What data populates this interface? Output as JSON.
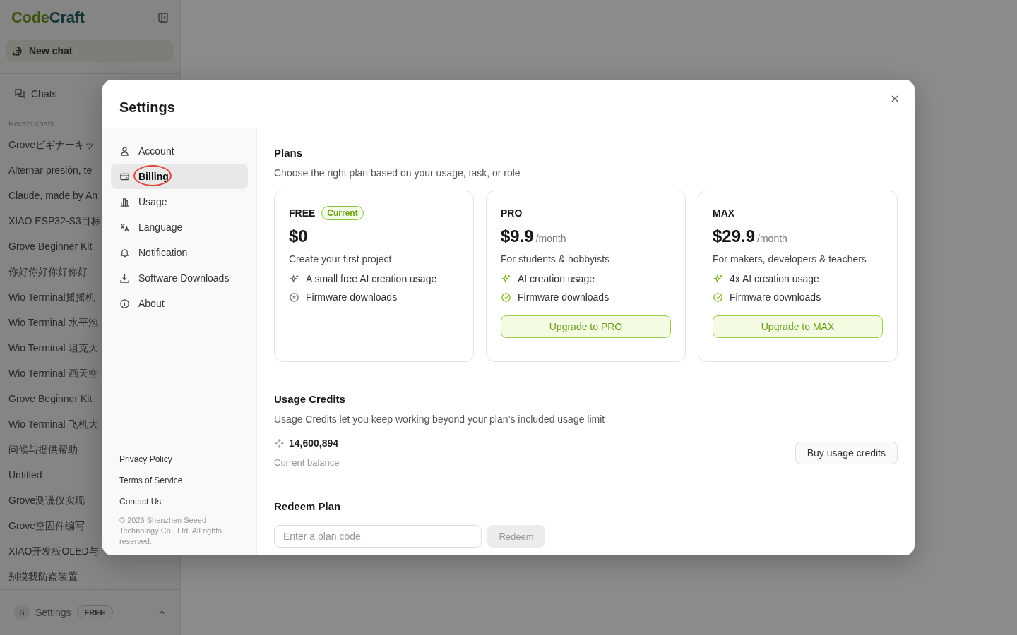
{
  "sidebar": {
    "logo": {
      "first": "Code",
      "second": "Craft"
    },
    "new_chat": "New chat",
    "chats": "Chats",
    "recent_label": "Recent chats",
    "recent_chats": [
      "Groveビギナーキッ",
      "Alternar presión, te",
      "Claude, made by An",
      "XIAO ESP32-S3目标",
      "Grove Beginner Kit",
      "你好你好你好你好",
      "Wio Terminal摇摇机",
      "Wio Terminal 水平泡",
      "Wio Terminal 坦克大",
      "Wio Terminal 画天空",
      "Grove Beginner Kit",
      "Wio Terminal 飞机大",
      "问候与提供帮助",
      "Untitled",
      "Grove测谎仪实现",
      "Grove空固件编写",
      "XIAO开发板OLED与",
      "别摸我防盗装置"
    ],
    "account": {
      "avatar": "S",
      "label": "Settings",
      "badge": "FREE"
    }
  },
  "settings": {
    "title": "Settings",
    "nav": [
      {
        "label": "Account",
        "kind": "account",
        "selected": false
      },
      {
        "label": "Billing",
        "kind": "billing",
        "selected": true
      },
      {
        "label": "Usage",
        "kind": "usage",
        "selected": false
      },
      {
        "label": "Language",
        "kind": "language",
        "selected": false
      },
      {
        "label": "Notification",
        "kind": "notification",
        "selected": false
      },
      {
        "label": "Software Downloads",
        "kind": "download",
        "selected": false
      },
      {
        "label": "About",
        "kind": "about",
        "selected": false
      }
    ],
    "footer_links": [
      "Privacy Policy",
      "Terms of Service",
      "Contact Us"
    ],
    "copyright": "© 2026 Shenzhen Seeed Technology Co., Ltd. All rights reserved.",
    "plans": {
      "title": "Plans",
      "subtitle": "Choose the right plan based on your usage, task, or role",
      "cards": [
        {
          "name": "FREE",
          "badge": "Current",
          "price": "$0",
          "description": "Create your first project",
          "features": [
            {
              "text": "A small free AI creation usage",
              "kind": "ai",
              "included": false
            },
            {
              "text": "Firmware downloads",
              "kind": "check",
              "included": false
            }
          ]
        },
        {
          "name": "PRO",
          "price": "$9.9",
          "period": "/month",
          "description": "For students & hobbyists",
          "features": [
            {
              "text": "AI creation usage",
              "kind": "ai",
              "included": true
            },
            {
              "text": "Firmware downloads",
              "kind": "check",
              "included": true
            }
          ],
          "button": "Upgrade to PRO"
        },
        {
          "name": "MAX",
          "price": "$29.9",
          "period": "/month",
          "description": "For makers, developers & teachers",
          "features": [
            {
              "text": "4x AI creation usage",
              "kind": "ai",
              "included": true
            },
            {
              "text": "Firmware downloads",
              "kind": "check",
              "included": true
            }
          ],
          "button": "Upgrade to MAX"
        }
      ]
    },
    "credits": {
      "title": "Usage Credits",
      "description": "Usage Credits let you keep working beyond your plan’s included usage limit",
      "balance": "14,600,894",
      "balance_label": "Current balance",
      "button": "Buy usage credits"
    },
    "redeem": {
      "title": "Redeem Plan",
      "placeholder": "Enter a plan code",
      "button": "Redeem",
      "disabled": true
    }
  }
}
